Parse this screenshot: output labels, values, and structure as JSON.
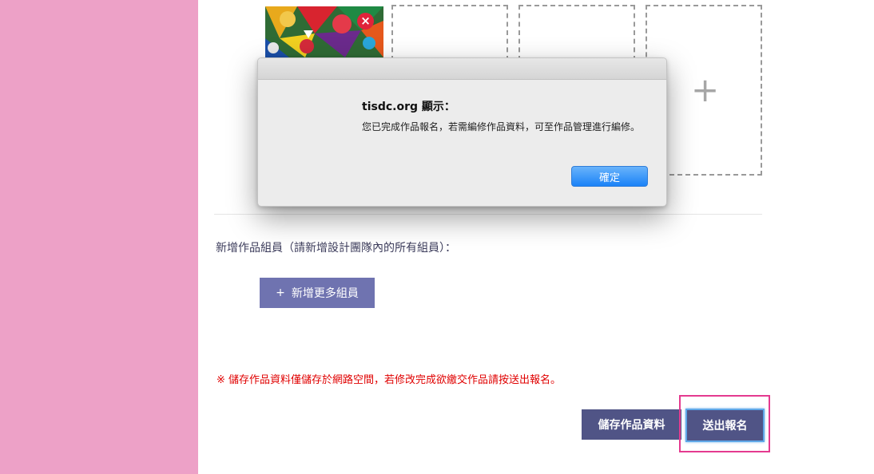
{
  "uploads": {
    "remove_icon": "×",
    "add_icon": "+"
  },
  "members": {
    "label": "新增作品組員（請新增設計團隊內的所有組員）：",
    "add_button_icon": "+",
    "add_button_label": "新增更多組員"
  },
  "notice": "※ 儲存作品資料僅儲存於網路空間，若修改完成欲繳交作品請按送出報名。",
  "actions": {
    "save_label": "儲存作品資料",
    "submit_label": "送出報名"
  },
  "dialog": {
    "title": "tisdc.org 顯示：",
    "message": "您已完成作品報名，若需編修作品資料，可至作品管理進行編修。",
    "ok_label": "確定"
  },
  "colors": {
    "sidebar": "#eda1c7",
    "button": "#505486",
    "add_member_button": "#6f73b0",
    "notice": "#e00000",
    "highlight": "#e43a8f",
    "dialog_button": "#1a82f7"
  }
}
